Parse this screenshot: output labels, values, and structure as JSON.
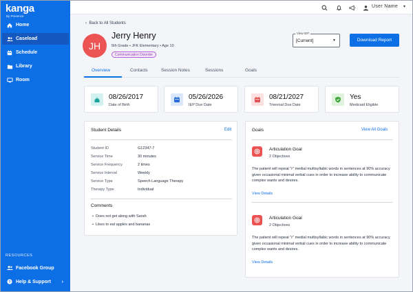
{
  "brand": {
    "name": "kanga",
    "tagline": "By Presence"
  },
  "sidebar": {
    "items": [
      {
        "label": "Home",
        "icon": "home-icon"
      },
      {
        "label": "Caseload",
        "icon": "people-icon",
        "active": true
      },
      {
        "label": "Schedule",
        "icon": "calendar-icon"
      },
      {
        "label": "Library",
        "icon": "folder-icon"
      },
      {
        "label": "Room",
        "icon": "monitor-icon"
      }
    ],
    "resources_title": "RESOURCES",
    "resources": [
      {
        "label": "Facebook Group",
        "icon": "people-icon"
      },
      {
        "label": "Help & Support",
        "icon": "help-icon"
      }
    ]
  },
  "topbar": {
    "user_name": "User Name"
  },
  "header": {
    "back_link": "Back to All Students",
    "initials": "JH",
    "name": "Jerry Henry",
    "subline": "5th Grade • JFK Elementary • Age 10",
    "badge": "Communication Disorder",
    "iep_label": "View IEP",
    "iep_value": "[Current]",
    "download_label": "Download Report"
  },
  "tabs": [
    "Overview",
    "Contacts",
    "Session Notes",
    "Sessions",
    "Goals"
  ],
  "stats": [
    {
      "value": "08/26/2017",
      "label": "Date of Birth",
      "icon": "cake-icon",
      "bg": "#d3f1f0",
      "fg": "#1aa39a"
    },
    {
      "value": "05/26/2026",
      "label": "IEP Due Date",
      "icon": "calendar-icon",
      "bg": "#dbe7fb",
      "fg": "#2b6fd6"
    },
    {
      "value": "08/21/2027",
      "label": "Triennial Due Date",
      "icon": "calendar-icon",
      "bg": "#fde0e0",
      "fg": "#e05555"
    },
    {
      "value": "Yes",
      "label": "Medicaid Eligible",
      "icon": "shield-check-icon",
      "bg": "#dff3dc",
      "fg": "#3ea33b"
    }
  ],
  "details": {
    "title": "Student Details",
    "edit_label": "Edit",
    "rows": [
      {
        "label": "Student ID",
        "value": "G12347-7"
      },
      {
        "label": "Service Time",
        "value": "30 minutes"
      },
      {
        "label": "Service Frequency",
        "value": "2 times"
      },
      {
        "label": "Service Interval",
        "value": "Weekly"
      },
      {
        "label": "Service Type",
        "value": "Speech Language Therapy"
      },
      {
        "label": "Therapy Type",
        "value": "Individual"
      }
    ],
    "comments_title": "Comments",
    "comments": [
      "Does not get along with Sarah",
      "Likes to eat apples and bananas"
    ]
  },
  "goals": {
    "title": "Goals",
    "view_all_label": "View All Goals",
    "items": [
      {
        "title": "Articulation Goal",
        "objectives": "2 Objectives",
        "description": "The patient will repeat \"r\" medial multisyllabic words in sentences at 90% accuracy given occasional minimal verbal cues in order to increase ability to communicate complex wants and desires.",
        "link": "View Details"
      },
      {
        "title": "Articulation Goal",
        "objectives": "2 Objectives",
        "description": "The patient will repeat \"r\" medial multisyllabic words in sentences at 90% accuracy given occasional minimal verbal cues in order to increase ability to communicate complex wants and desires.",
        "link": "View Details"
      }
    ]
  }
}
